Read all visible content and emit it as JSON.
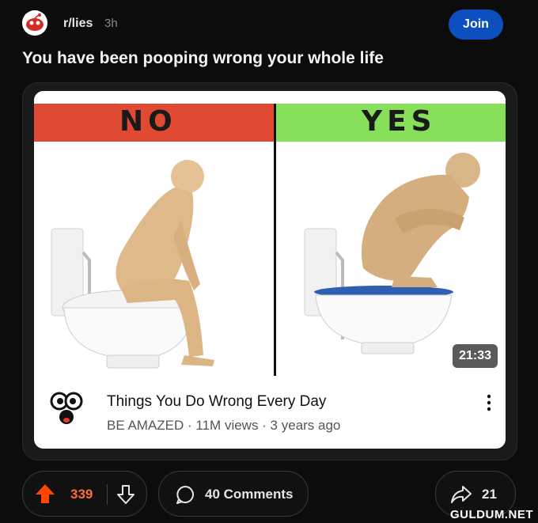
{
  "post": {
    "subreddit": "r/lies",
    "time_ago": "3h",
    "join_label": "Join",
    "title": "You have been pooping wrong your whole life"
  },
  "video": {
    "banner_no": "NO",
    "banner_yes": "YES",
    "duration": "21:33",
    "title": "Things You Do Wrong Every Day",
    "meta": "BE AMAZED · 11M views · 3 years ago"
  },
  "actions": {
    "upvotes": "339",
    "comments_label": "40 Comments",
    "shares": "21"
  },
  "watermark": "GULDUM.NET",
  "colors": {
    "background": "#0c0c0d",
    "join": "#0e4fc0",
    "upvote": "#ff4500",
    "banner_no": "#e04a33",
    "banner_yes": "#86e05a"
  }
}
